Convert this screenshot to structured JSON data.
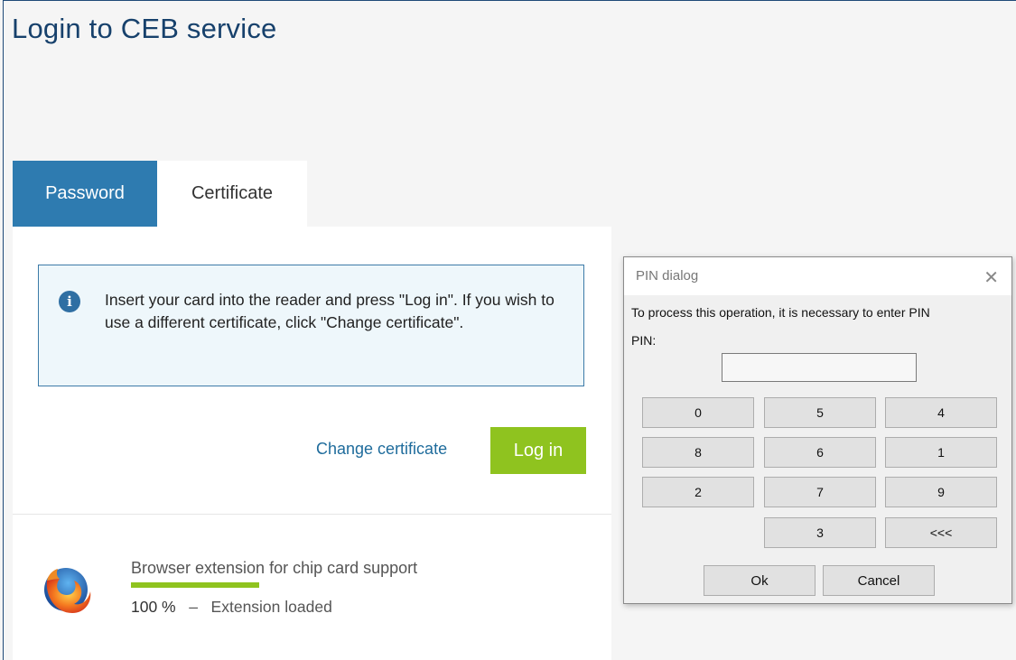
{
  "page": {
    "title": "Login to CEB service"
  },
  "tabs": {
    "password": "Password",
    "certificate": "Certificate"
  },
  "info": {
    "icon": "info-icon",
    "text": "Insert your card into the reader and press \"Log in\". If you wish to use a different certificate, click \"Change certificate\"."
  },
  "actions": {
    "change_certificate": "Change certificate",
    "login": "Log in"
  },
  "extension": {
    "icon": "firefox-logo-icon",
    "title": "Browser extension for chip card support",
    "progress_percent": 100,
    "percent_label": "100 %",
    "separator": "–",
    "status": "Extension loaded"
  },
  "pin_dialog": {
    "title": "PIN dialog",
    "close_icon": "close-icon",
    "message": "To process this operation, it is necessary to enter PIN",
    "pin_label": "PIN:",
    "pin_value": "",
    "keys": {
      "k0": "0",
      "k1": "5",
      "k2": "4",
      "k3": "8",
      "k4": "6",
      "k5": "1",
      "k6": "2",
      "k7": "7",
      "k8": "9",
      "k9": "3",
      "backspace": "<<<"
    },
    "ok": "Ok",
    "cancel": "Cancel"
  },
  "colors": {
    "title": "#17416c",
    "tab_active": "#2e7bb0",
    "login_button": "#8fc31f",
    "link": "#1f6c9c",
    "progress": "#8fc31f"
  }
}
